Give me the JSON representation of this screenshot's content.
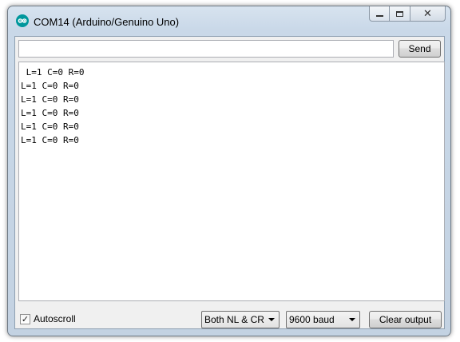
{
  "window": {
    "title": "COM14 (Arduino/Genuino Uno)",
    "icon": "arduino-logo-icon",
    "controls": [
      "minimize-icon",
      "maximize-icon",
      "close-icon"
    ],
    "close_glyph": "✕"
  },
  "send": {
    "input_value": "",
    "button_label": "Send"
  },
  "output": {
    "lines": [
      " L=1 C=0 R=0",
      "L=1 C=0 R=0",
      "L=1 C=0 R=0",
      "L=1 C=0 R=0",
      "L=1 C=0 R=0",
      "L=1 C=0 R=0"
    ]
  },
  "footer": {
    "autoscroll_label": "Autoscroll",
    "autoscroll_checked": true,
    "checkmark": "✓",
    "line_ending": "Both NL & CR",
    "baud_rate": "9600 baud",
    "clear_label": "Clear output"
  },
  "colors": {
    "arduino_teal": "#00979c",
    "frame": "#c9d8e8"
  }
}
